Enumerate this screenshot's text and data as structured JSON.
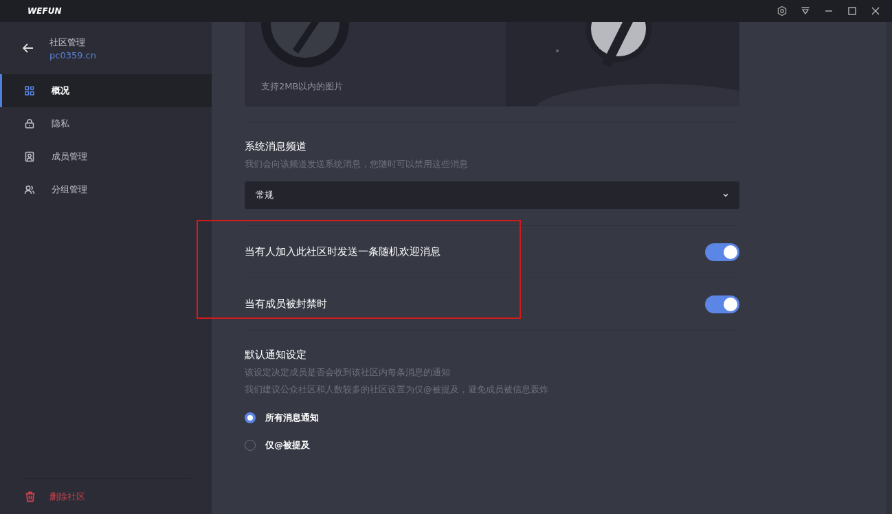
{
  "window": {
    "app_name": "WEFUN"
  },
  "sidebar": {
    "title": "社区管理",
    "subtitle": "pc0359.cn",
    "items": [
      {
        "label": "概况",
        "selected": true
      },
      {
        "label": "隐私",
        "selected": false
      },
      {
        "label": "成员管理",
        "selected": false
      },
      {
        "label": "分组管理",
        "selected": false
      }
    ],
    "delete_label": "删除社区"
  },
  "banner": {
    "caption": "支持2MB以内的图片"
  },
  "system_channel": {
    "title": "系统消息频道",
    "description": "我们会向该频道发送系统消息，您随时可以禁用这些消息",
    "value": "常规"
  },
  "toggles": [
    {
      "label": "当有人加入此社区时发送一条随机欢迎消息",
      "on": true
    },
    {
      "label": "当有成员被封禁时",
      "on": true
    }
  ],
  "notifications": {
    "title": "默认通知设定",
    "descriptions": [
      "该设定决定成员是否会收到该社区内每条消息的通知",
      "我们建议公众社区和人数较多的社区设置为仅@被提及，避免成员被信息轰炸"
    ],
    "options": [
      {
        "label": "所有消息通知",
        "selected": true
      },
      {
        "label": "仅@被提及",
        "selected": false
      }
    ]
  }
}
